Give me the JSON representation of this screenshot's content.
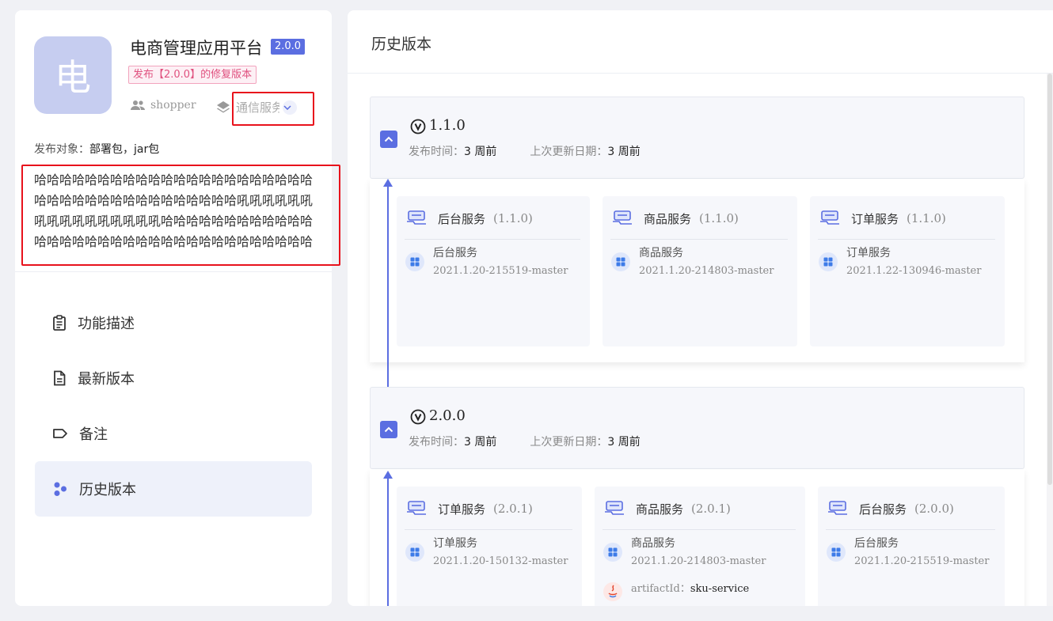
{
  "app": {
    "avatar_char": "电",
    "title": "电商管理应用平台",
    "version": "2.0.0",
    "release_tag": "发布【2.0.0】的修复版本",
    "owner": "shopper",
    "category": "通信服务",
    "publish_target_label": "发布对象：",
    "publish_target_value": "部署包，jar包",
    "description": "哈哈哈哈哈哈哈哈哈哈哈哈哈哈哈哈哈哈哈哈哈哈哈哈哈哈哈哈哈哈哈哈哈哈哈哈哈哈吼吼吼吼吼吼吼吼吼吼吼吼吼吼吼吼哈哈哈哈哈哈哈哈哈哈哈哈哈哈哈哈哈哈哈哈哈哈哈哈哈哈哈哈哈哈哈哈哈哈"
  },
  "nav": {
    "items": [
      {
        "label": "功能描述",
        "icon": "clipboard-icon"
      },
      {
        "label": "最新版本",
        "icon": "document-icon"
      },
      {
        "label": "备注",
        "icon": "tag-icon"
      },
      {
        "label": "历史版本",
        "icon": "history-icon",
        "active": true
      }
    ]
  },
  "history": {
    "title": "历史版本",
    "versions": [
      {
        "version": "1.1.0",
        "release_label": "发布时间：",
        "release_value": "3 周前",
        "updated_label": "上次更新日期：",
        "updated_value": "3 周前",
        "services": [
          {
            "name": "后台服务",
            "ver": "(1.1.0)",
            "item_name": "后台服务",
            "build": "2021.1.20-215519-master"
          },
          {
            "name": "商品服务",
            "ver": "(1.1.0)",
            "item_name": "商品服务",
            "build": "2021.1.20-214803-master"
          },
          {
            "name": "订单服务",
            "ver": "(1.1.0)",
            "item_name": "订单服务",
            "build": "2021.1.22-130946-master"
          }
        ]
      },
      {
        "version": "2.0.0",
        "release_label": "发布时间：",
        "release_value": "3 周前",
        "updated_label": "上次更新日期：",
        "updated_value": "3 周前",
        "services": [
          {
            "name": "订单服务",
            "ver": "(2.0.1)",
            "item_name": "订单服务",
            "build": "2021.1.20-150132-master"
          },
          {
            "name": "商品服务",
            "ver": "(2.0.1)",
            "item_name": "商品服务",
            "build": "2021.1.20-214803-master",
            "artifact_label": "artifactId：",
            "artifact_value": "sku-service"
          },
          {
            "name": "后台服务",
            "ver": "(2.0.0)",
            "item_name": "后台服务",
            "build": "2021.1.20-215519-master"
          }
        ]
      }
    ]
  },
  "colors": {
    "accent": "#5b6ee1",
    "highlight_box": "#e8121c",
    "tag_text": "#e0517f"
  }
}
